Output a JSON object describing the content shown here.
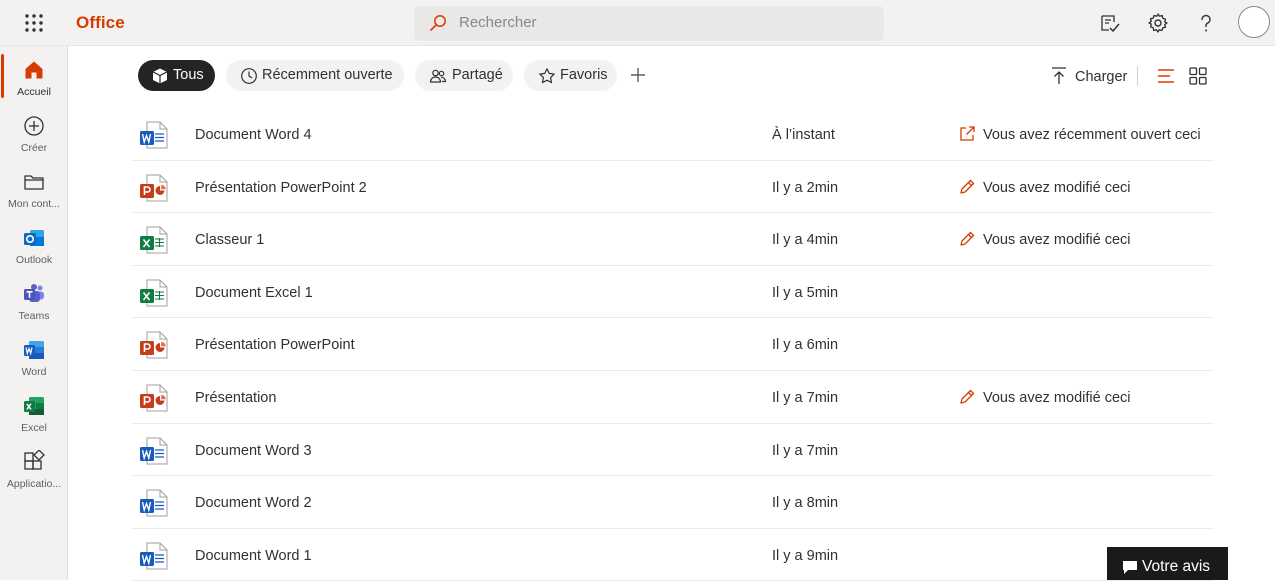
{
  "header": {
    "brand": "Office",
    "search_placeholder": "Rechercher"
  },
  "rail": {
    "items": [
      {
        "label": "Accueil"
      },
      {
        "label": "Créer"
      },
      {
        "label": "Mon cont..."
      },
      {
        "label": "Outlook"
      },
      {
        "label": "Teams"
      },
      {
        "label": "Word"
      },
      {
        "label": "Excel"
      },
      {
        "label": "Applicatio..."
      }
    ]
  },
  "filters": {
    "tabs": [
      {
        "label": "Tous",
        "icon": "cube-icon"
      },
      {
        "label": "Récemment ouverte",
        "icon": "clock-icon"
      },
      {
        "label": "Partagé",
        "icon": "people-icon"
      },
      {
        "label": "Favoris",
        "icon": "star-icon"
      }
    ],
    "selected": "Tous"
  },
  "toolbar": {
    "upload_label": "Charger"
  },
  "files": [
    {
      "name": "Document Word 4",
      "type": "word",
      "time": "À l’instant",
      "activity": "Vous avez récemment ouvert ceci",
      "activity_icon": "open-icon"
    },
    {
      "name": "Présentation PowerPoint 2",
      "type": "powerpoint",
      "time": "Il y a 2min",
      "activity": "Vous avez modifié ceci",
      "activity_icon": "pencil-icon"
    },
    {
      "name": "Classeur 1",
      "type": "excel",
      "time": "Il y a 4min",
      "activity": "Vous avez modifié ceci",
      "activity_icon": "pencil-icon"
    },
    {
      "name": "Document Excel 1",
      "type": "excel",
      "time": "Il y a 5min",
      "activity": "",
      "activity_icon": ""
    },
    {
      "name": "Présentation PowerPoint",
      "type": "powerpoint",
      "time": "Il y a 6min",
      "activity": "",
      "activity_icon": ""
    },
    {
      "name": "Présentation",
      "type": "powerpoint",
      "time": "Il y a 7min",
      "activity": "Vous avez modifié ceci",
      "activity_icon": "pencil-icon"
    },
    {
      "name": "Document Word 3",
      "type": "word",
      "time": "Il y a 7min",
      "activity": "",
      "activity_icon": ""
    },
    {
      "name": "Document Word 2",
      "type": "word",
      "time": "Il y a 8min",
      "activity": "",
      "activity_icon": ""
    },
    {
      "name": "Document Word 1",
      "type": "word",
      "time": "Il y a 9min",
      "activity": "",
      "activity_icon": ""
    }
  ],
  "feedback": {
    "label": "Votre avis"
  },
  "colors": {
    "accent": "#d83b01",
    "word": "#185abd",
    "excel": "#107c41",
    "powerpoint": "#c43e1c",
    "outlook": "#0f6cbd",
    "teams": "#5b5fc7"
  }
}
